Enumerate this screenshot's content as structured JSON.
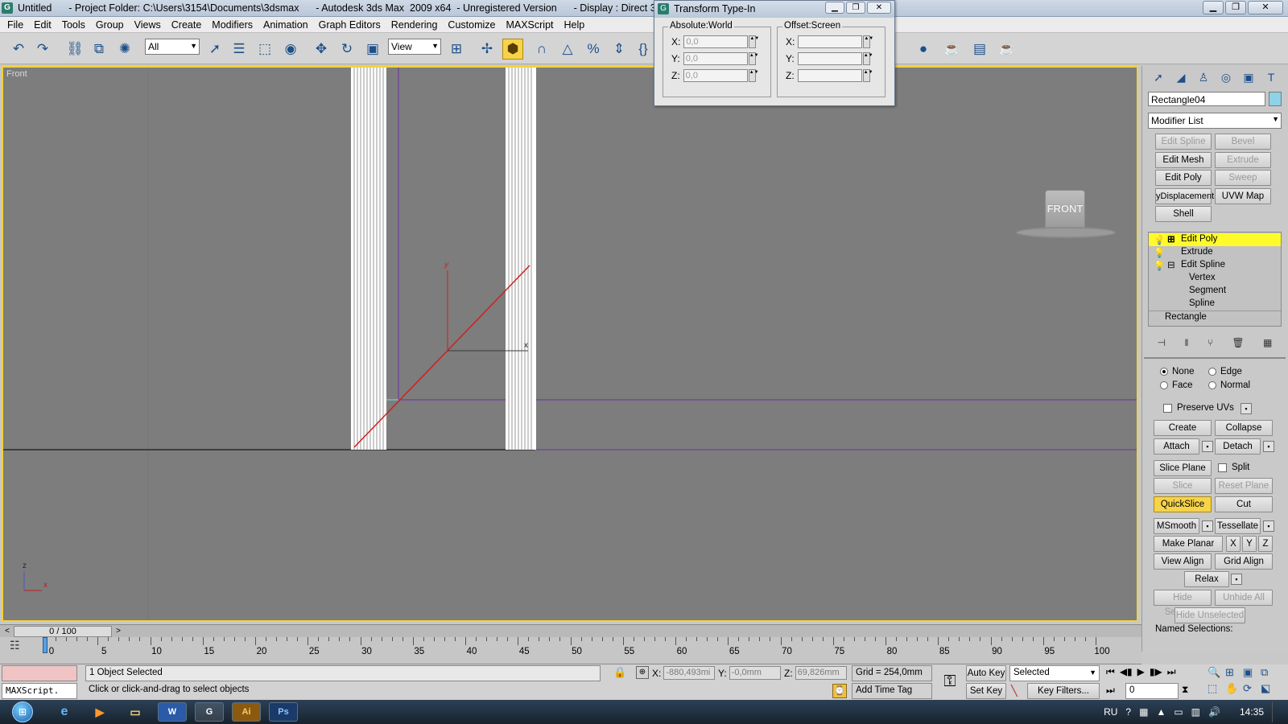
{
  "window": {
    "title": "Untitled      - Project Folder: C:\\Users\\3154\\Documents\\3dsmax      - Autodesk 3ds Max  2009 x64  - Unregistered Version      - Display : Direct 3D"
  },
  "menu": [
    "File",
    "Edit",
    "Tools",
    "Group",
    "Views",
    "Create",
    "Modifiers",
    "Animation",
    "Graph Editors",
    "Rendering",
    "Customize",
    "MAXScript",
    "Help"
  ],
  "toolbar": {
    "selection_filter": "All",
    "reference_coord": "View"
  },
  "viewport": {
    "label": "Front",
    "viewcube_label": "FRONT",
    "gizmo": {
      "y": "y",
      "x": "x"
    },
    "axis": {
      "z": "z",
      "x": "x"
    }
  },
  "transform_dialog": {
    "title": "Transform Type-In",
    "absolute": {
      "label": "Absolute:World",
      "x": "0,0",
      "y": "0,0",
      "z": "0,0"
    },
    "offset": {
      "label": "Offset:Screen",
      "x": "",
      "y": "",
      "z": ""
    },
    "x_label": "X:",
    "y_label": "Y:",
    "z_label": "Z:"
  },
  "command_panel": {
    "object_name": "Rectangle04",
    "color": "#8ed2e7",
    "modifier_list": "Modifier List",
    "modifier_buttons": [
      {
        "label": "Edit Spline",
        "enabled": false
      },
      {
        "label": "Bevel",
        "enabled": false
      },
      {
        "label": "Edit Mesh",
        "enabled": true
      },
      {
        "label": "Extrude",
        "enabled": false
      },
      {
        "label": "Edit Poly",
        "enabled": true
      },
      {
        "label": "Sweep",
        "enabled": false
      },
      {
        "label": "yDisplacement",
        "enabled": true
      },
      {
        "label": "UVW Map",
        "enabled": true
      },
      {
        "label": "Shell",
        "enabled": true
      }
    ],
    "stack": [
      {
        "label": "Edit Poly",
        "selected": true
      },
      {
        "label": "Extrude",
        "selected": false
      },
      {
        "label": "Edit Spline",
        "selected": false
      },
      {
        "label": "Vertex",
        "selected": false
      },
      {
        "label": "Segment",
        "selected": false
      },
      {
        "label": "Spline",
        "selected": false
      },
      {
        "label": "Rectangle",
        "selected": false
      }
    ],
    "constraints": {
      "none": "None",
      "edge": "Edge",
      "face": "Face",
      "normal": "Normal"
    },
    "preserve_uvs": "Preserve UVs",
    "buttons": {
      "create": "Create",
      "collapse": "Collapse",
      "attach": "Attach",
      "detach": "Detach",
      "slice_plane": "Slice Plane",
      "split": "Split",
      "slice": "Slice",
      "reset_plane": "Reset Plane",
      "quickslice": "QuickSlice",
      "cut": "Cut",
      "msmooth": "MSmooth",
      "tessellate": "Tessellate",
      "make_planar": "Make Planar",
      "x": "X",
      "y": "Y",
      "z": "Z",
      "view_align": "View Align",
      "grid_align": "Grid Align",
      "relax": "Relax",
      "hide_selected": "Hide Selected",
      "unhide_all": "Unhide All",
      "hide_unselected": "Hide Unselected"
    },
    "named_selections": "Named Selections:"
  },
  "timeline": {
    "slider": "0 / 100",
    "ticks": [
      "0",
      "5",
      "10",
      "15",
      "20",
      "25",
      "30",
      "35",
      "40",
      "45",
      "50",
      "55",
      "60",
      "65",
      "70",
      "75",
      "80",
      "85",
      "90",
      "95",
      "100"
    ]
  },
  "status": {
    "maxscript": "MAXScript.",
    "selected": "1 Object Selected",
    "prompt": "Click or click-and-drag to select objects",
    "x": "-880,493mi",
    "y": "-0,0mm",
    "z": "69,826mm",
    "grid": "Grid = 254,0mm",
    "add_time_tag": "Add Time Tag",
    "auto_key": "Auto Key",
    "set_key": "Set Key",
    "selected_dropdown": "Selected",
    "key_filters": "Key Filters...",
    "frame": "0"
  },
  "taskbar": {
    "lang": "RU",
    "time": "14:35"
  }
}
